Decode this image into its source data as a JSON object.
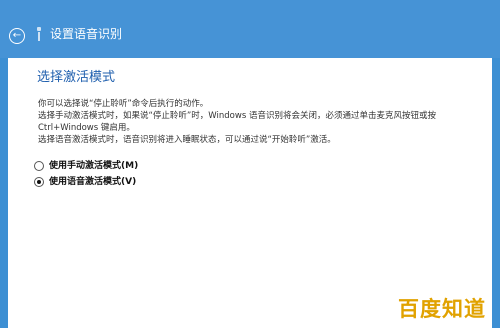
{
  "window": {
    "title": "设置语音识别",
    "colors": {
      "title_bar": "#4693d6",
      "accent": "#1f5fae",
      "panel": "#ffffff"
    },
    "icons": {
      "back": "back-arrow-icon",
      "mic": "microphone-icon"
    }
  },
  "page": {
    "heading": "选择激活模式",
    "description_lines": [
      "你可以选择说“停止聆听”命令后执行的动作。",
      "选择手动激活模式时，如果说“停止聆听”时，Windows 语音识别将会关闭，必须通过单击麦克风按钮或按",
      "Ctrl+Windows 键启用。",
      "选择语音激活模式时，语音识别将进入睡眠状态，可以通过说“开始聆听”激活。"
    ],
    "options": [
      {
        "label": "使用手动激活模式(M)",
        "selected": false
      },
      {
        "label": "使用语音激活模式(V)",
        "selected": true
      }
    ]
  },
  "watermark": {
    "text": "百度知道"
  }
}
